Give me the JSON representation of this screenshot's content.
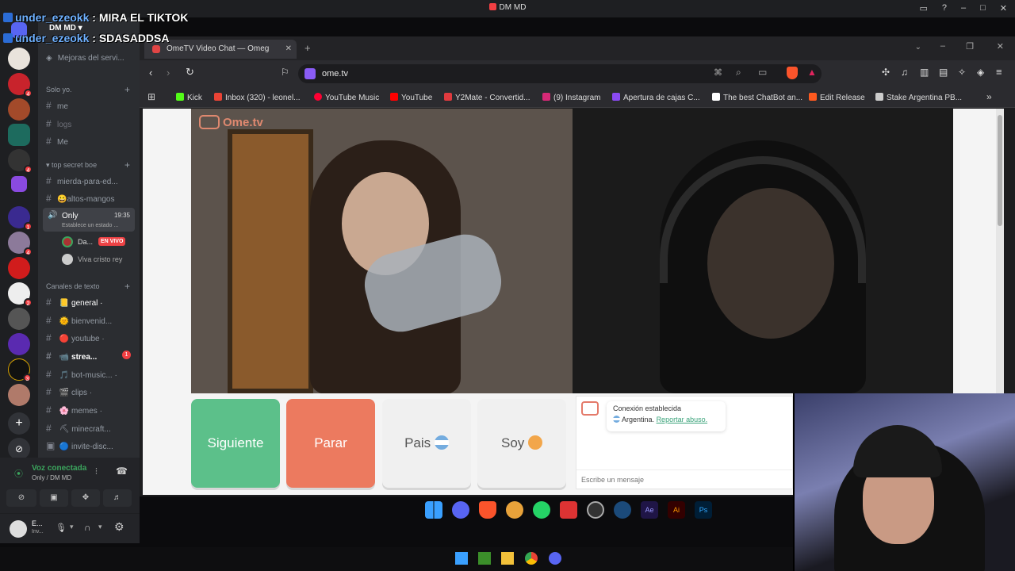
{
  "window": {
    "title": "DM MD"
  },
  "overlay_chat": [
    {
      "user": "under_ezeokk",
      "message": ": MIRA EL TIKTOK"
    },
    {
      "user": "under_ezeokk",
      "message": ": SDASADDSA"
    }
  ],
  "discord": {
    "server_name": "DM MD",
    "nav_top": "Mejoras del servi...",
    "categories": {
      "solo": "Solo yo.",
      "top": "top secret boe",
      "text": "Canales de texto"
    },
    "solo_channels": [
      "me",
      "logs",
      "Me"
    ],
    "top_channels": [
      "mierda-para-ed...",
      "altos-mangos"
    ],
    "voice_channel": {
      "name": "Only",
      "time": "19:35",
      "status": "Establece un estado ..."
    },
    "voice_members": [
      {
        "name": "Da...",
        "badge": "EN VIVO"
      },
      {
        "name": "Viva cristo rey",
        "badge": ""
      }
    ],
    "text_channels": [
      {
        "name": "general",
        "emoji": "📒",
        "unread": ""
      },
      {
        "name": "bienvenid...",
        "emoji": "🌞",
        "unread": ""
      },
      {
        "name": "youtube",
        "emoji": "🔴",
        "unread": ""
      },
      {
        "name": "strea...",
        "emoji": "📹",
        "unread": "1"
      },
      {
        "name": "bot-music...",
        "emoji": "🎵",
        "unread": ""
      },
      {
        "name": "clips",
        "emoji": "🎬",
        "unread": ""
      },
      {
        "name": "memes",
        "emoji": "🌸",
        "unread": ""
      },
      {
        "name": "minecraft...",
        "emoji": "⛏",
        "unread": ""
      },
      {
        "name": "invite-disc...",
        "emoji": "🔵",
        "unread": ""
      }
    ],
    "voice_connected": {
      "title": "Voz conectada",
      "subtitle": "Only / DM MD"
    },
    "user": {
      "name": "E...",
      "status": "Inv..."
    },
    "server_badges": [
      "",
      "4",
      "",
      "",
      "4",
      "",
      "1",
      "4",
      "",
      "2",
      "",
      "",
      "3",
      "",
      ""
    ]
  },
  "browser": {
    "tab_title": "OmeTV Video Chat — Omeg",
    "url": "ome.tv",
    "bookmarks": [
      {
        "label": "Kick",
        "color": "#53fc18"
      },
      {
        "label": "Inbox (320) - leonel...",
        "color": "#ea4335"
      },
      {
        "label": "YouTube Music",
        "color": "#ff0033"
      },
      {
        "label": "YouTube",
        "color": "#ff0000"
      },
      {
        "label": "Y2Mate - Convertid...",
        "color": "#e03a3e"
      },
      {
        "label": "(9) Instagram",
        "color": "#d62976"
      },
      {
        "label": "Apertura de cajas C...",
        "color": "#8a4af3"
      },
      {
        "label": "The best ChatBot an...",
        "color": "#ffffff"
      },
      {
        "label": "Edit Release",
        "color": "#ff5a1f"
      },
      {
        "label": "Stake Argentina PB...",
        "color": "#cccccc"
      }
    ]
  },
  "ometv": {
    "logo": "Ome.tv",
    "buttons": {
      "next": "Siguiente",
      "stop": "Parar",
      "country": "Pais",
      "gender": "Soy"
    },
    "status": {
      "line1": "Conexión establecida",
      "country": "Argentina.",
      "report": "Reportar abuso."
    },
    "input_placeholder": "Escribe un mensaje"
  },
  "colors": {
    "next": "#5cc08a",
    "stop": "#ec7a5f",
    "discord_bg": "#2b2d31",
    "live_badge": "#ed4245"
  }
}
